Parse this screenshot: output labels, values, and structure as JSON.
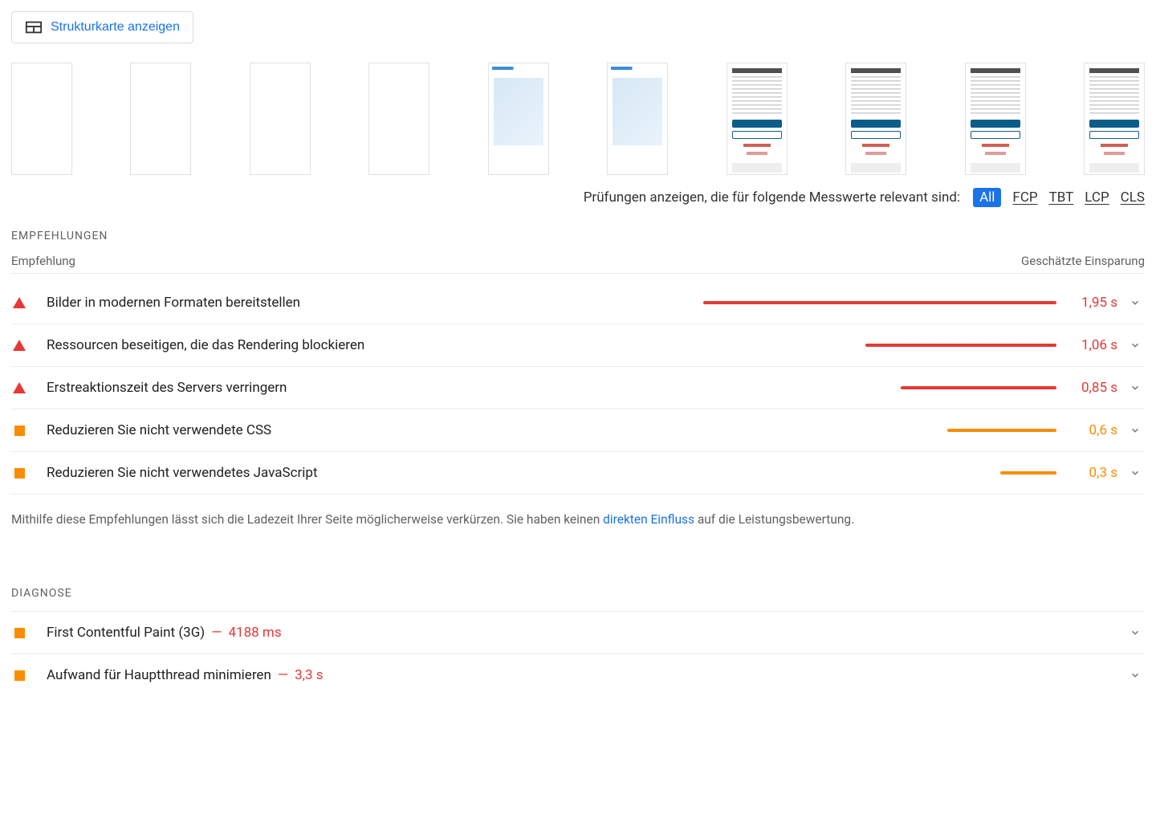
{
  "toolbar": {
    "treemap_label": "Strukturkarte anzeigen"
  },
  "filter": {
    "prompt": "Prüfungen anzeigen, die für folgende Messwerte relevant sind:",
    "pills": [
      "All",
      "FCP",
      "TBT",
      "LCP",
      "CLS"
    ],
    "active": "All"
  },
  "opportunities": {
    "heading": "EMPFEHLUNGEN",
    "col_left": "Empfehlung",
    "col_right": "Geschätzte Einsparung",
    "items": [
      {
        "severity": "red",
        "title": "Bilder in modernen Formaten bereitstellen",
        "bar_pct": 100,
        "savings": "1,95 s"
      },
      {
        "severity": "red",
        "title": "Ressourcen beseitigen, die das Rendering blockieren",
        "bar_pct": 54,
        "savings": "1,06 s"
      },
      {
        "severity": "red",
        "title": "Erstreaktionszeit des Servers verringern",
        "bar_pct": 44,
        "savings": "0,85 s"
      },
      {
        "severity": "orange",
        "title": "Reduzieren Sie nicht verwendete CSS",
        "bar_pct": 31,
        "savings": "0,6 s"
      },
      {
        "severity": "orange",
        "title": "Reduzieren Sie nicht verwendetes JavaScript",
        "bar_pct": 16,
        "savings": "0,3 s"
      }
    ],
    "footnote_pre": "Mithilfe diese Empfehlungen lässt sich die Ladezeit Ihrer Seite möglicherweise verkürzen. Sie haben keinen ",
    "footnote_link": "direkten Einfluss",
    "footnote_post": " auf die Leistungsbewertung."
  },
  "diagnostics": {
    "heading": "DIAGNOSE",
    "items": [
      {
        "severity": "orange",
        "title": "First Contentful Paint (3G)",
        "metric": "4188 ms"
      },
      {
        "severity": "orange",
        "title": "Aufwand für Hauptthread minimieren",
        "metric": "3,3 s"
      }
    ]
  },
  "filmstrip": {
    "frames": [
      {
        "kind": "blank"
      },
      {
        "kind": "blank"
      },
      {
        "kind": "blank"
      },
      {
        "kind": "blank"
      },
      {
        "kind": "hero"
      },
      {
        "kind": "hero"
      },
      {
        "kind": "modal"
      },
      {
        "kind": "modal"
      },
      {
        "kind": "modal"
      },
      {
        "kind": "modal"
      }
    ]
  }
}
